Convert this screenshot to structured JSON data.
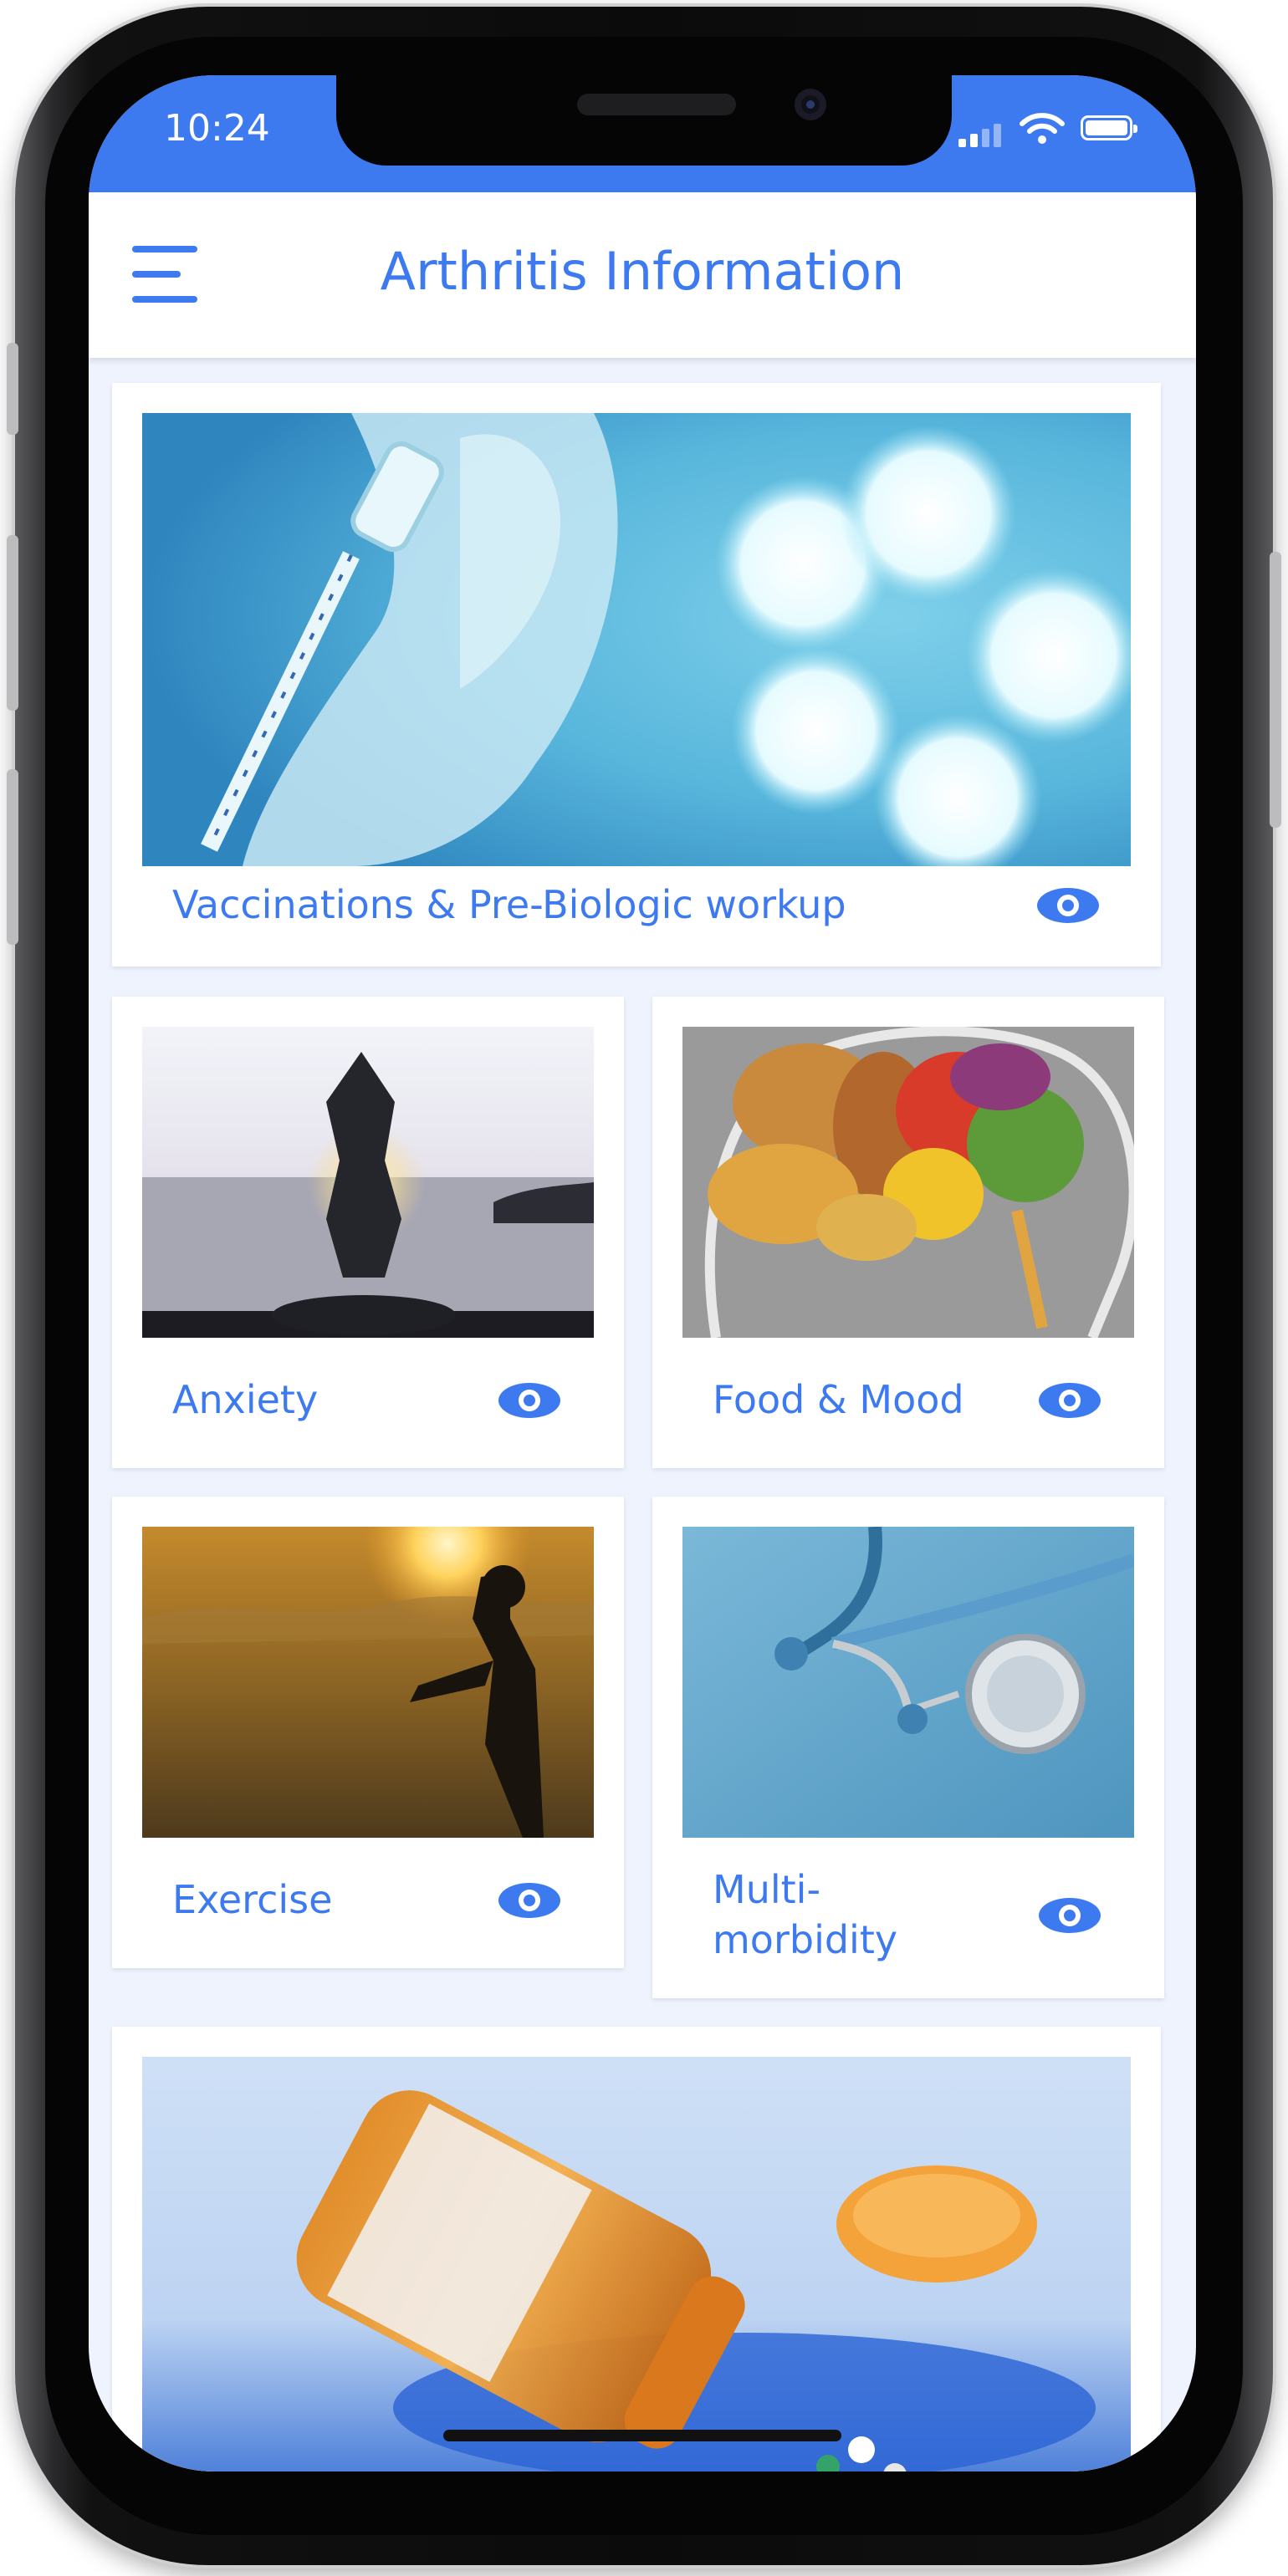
{
  "status_bar": {
    "time": "10:24"
  },
  "header": {
    "title": "Arthritis Information",
    "menu_icon": "hamburger-menu-icon"
  },
  "cards": [
    {
      "id": "vaccinations",
      "label": "Vaccinations & Pre-Biologic workup",
      "icon": "eye-icon",
      "image": "vaccine-syringe-photo"
    },
    {
      "id": "anxiety",
      "label": "Anxiety",
      "icon": "eye-icon",
      "image": "yoga-silhouette-photo"
    },
    {
      "id": "food-mood",
      "label": "Food & Mood",
      "icon": "eye-icon",
      "image": "food-brain-photo"
    },
    {
      "id": "exercise",
      "label": "Exercise",
      "icon": "eye-icon",
      "image": "running-woman-photo"
    },
    {
      "id": "multimorbidity",
      "label": "Multi-\nmorbidity",
      "icon": "eye-icon",
      "image": "stethoscope-photo"
    },
    {
      "id": "medication",
      "label": "",
      "icon": "",
      "image": "pill-bottle-photo"
    }
  ],
  "colors": {
    "accent": "#3d7af0",
    "background": "#eef3fd",
    "card": "#ffffff"
  }
}
